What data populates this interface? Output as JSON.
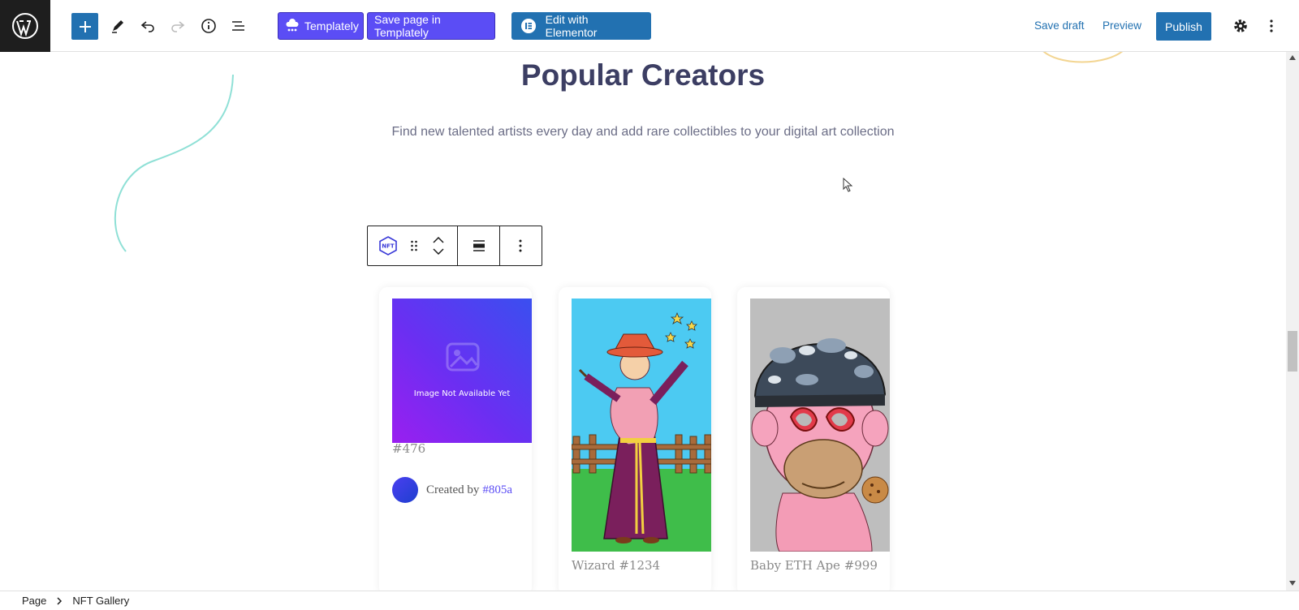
{
  "toolbar": {
    "templately_label": "Templately",
    "save_templately_label": "Save page in Templately",
    "elementor_label": "Edit with Elementor",
    "save_draft_label": "Save draft",
    "preview_label": "Preview",
    "publish_label": "Publish"
  },
  "content": {
    "heading": "Popular Creators",
    "subtitle": "Find new talented artists every day and add rare collectibles to your digital art collection"
  },
  "cards": [
    {
      "image_text": "Image Not Available Yet",
      "title": "#476",
      "created_by_label": "Created by",
      "creator": "#805a"
    },
    {
      "title": "Wizard #1234"
    },
    {
      "title": "Baby ETH Ape #999"
    }
  ],
  "block_toolbar": {
    "block_icon_label": "NFT"
  },
  "breadcrumb": {
    "items": [
      "Page",
      "NFT Gallery"
    ]
  },
  "colors": {
    "accent": "#2271b1",
    "templately": "#5b4df5",
    "heading": "#3c3e63"
  }
}
